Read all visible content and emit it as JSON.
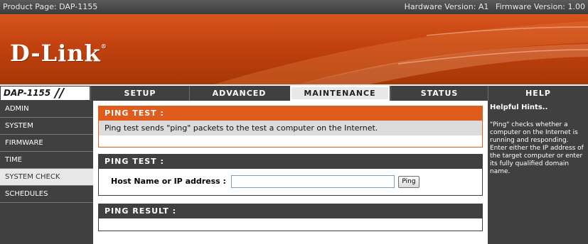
{
  "topbar": {
    "product": "Product Page: DAP-1155",
    "hardware": "Hardware Version: A1",
    "firmware": "Firmware Version: 1.00"
  },
  "banner": {
    "logo": "D-Link",
    "logo_mark": "®"
  },
  "nav": {
    "model": "DAP-1155",
    "model_slashes": "//",
    "tabs": [
      {
        "label": "SETUP"
      },
      {
        "label": "ADVANCED"
      },
      {
        "label": "MAINTENANCE"
      },
      {
        "label": "STATUS"
      },
      {
        "label": "HELP"
      }
    ],
    "active_tab": "MAINTENANCE"
  },
  "sidebar": {
    "items": [
      {
        "label": "ADMIN"
      },
      {
        "label": "SYSTEM"
      },
      {
        "label": "FIRMWARE"
      },
      {
        "label": "TIME"
      },
      {
        "label": "SYSTEM CHECK"
      },
      {
        "label": "SCHEDULES"
      }
    ],
    "active_item": "SYSTEM CHECK"
  },
  "ping_intro": {
    "title": "PING TEST :",
    "description": "Ping test sends \"ping\" packets to the test a computer on the Internet."
  },
  "ping_test": {
    "title": "PING TEST :",
    "host_label": "Host Name or IP address :",
    "host_value": "",
    "ping_button": "Ping"
  },
  "ping_result": {
    "title": "PING RESULT :"
  },
  "help": {
    "title": "Helpful Hints..",
    "text": "\"Ping\" checks whether a computer on the Internet is running and responding. Enter either the IP address of the target computer or enter its fully qualified domain name."
  },
  "colors": {
    "accent_orange": "#e05c1c",
    "dark_gray": "#404040",
    "banner": "#c2410f"
  }
}
